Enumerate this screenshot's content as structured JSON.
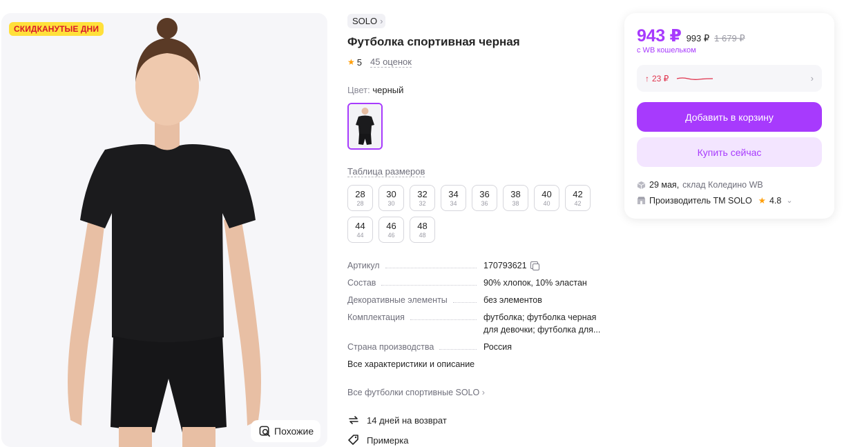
{
  "gallery": {
    "badge": "СКИДКАНУТЫЕ ДНИ",
    "similar_label": "Похожие"
  },
  "product": {
    "brand": "SOLO",
    "title": "Футболка спортивная черная",
    "rating": "5",
    "reviews": "45 оценок",
    "color_label": "Цвет:",
    "color_value": "черный",
    "size_table_label": "Таблица размеров",
    "sizes": [
      {
        "size": "28",
        "sub": "28"
      },
      {
        "size": "30",
        "sub": "30"
      },
      {
        "size": "32",
        "sub": "32"
      },
      {
        "size": "34",
        "sub": "34"
      },
      {
        "size": "36",
        "sub": "36"
      },
      {
        "size": "38",
        "sub": "38"
      },
      {
        "size": "40",
        "sub": "40"
      },
      {
        "size": "42",
        "sub": "42"
      },
      {
        "size": "44",
        "sub": "44"
      },
      {
        "size": "46",
        "sub": "46"
      },
      {
        "size": "48",
        "sub": "48"
      }
    ],
    "specs": [
      {
        "key": "Артикул",
        "value": "170793621"
      },
      {
        "key": "Состав",
        "value": "90% хлопок, 10% эластан"
      },
      {
        "key": "Декоративные элементы",
        "value": "без элементов"
      },
      {
        "key": "Комплектация",
        "value": "футболка; футболка черная для девочки; футболка для..."
      },
      {
        "key": "Страна производства",
        "value": "Россия"
      }
    ],
    "all_specs_link": "Все характеристики и описание",
    "all_tshirts_link": "Все футболки спортивные SOLO",
    "perks": [
      {
        "icon": "return-icon",
        "label": "14 дней на возврат"
      },
      {
        "icon": "tag-icon",
        "label": "Примерка"
      }
    ]
  },
  "purchase": {
    "price": "943 ₽",
    "price_second": "993 ₽",
    "price_old": "1 679 ₽",
    "wallet_note": "с WB кошельком",
    "history_arrow": "↑",
    "history_amount": "23 ₽",
    "add_to_cart": "Добавить в корзину",
    "buy_now": "Купить сейчас",
    "delivery_date": "29 мая,",
    "delivery_warehouse": "склад Коледино WB",
    "seller": "Производитель ТМ SOLO",
    "seller_rating": "4.8"
  },
  "colors": {
    "accent": "#a73afd",
    "accent_light": "#f3e5ff",
    "badge_bg": "#ffe03b",
    "badge_text": "#d8172a",
    "price_up": "#e0324c",
    "star": "#ff9f0a"
  }
}
